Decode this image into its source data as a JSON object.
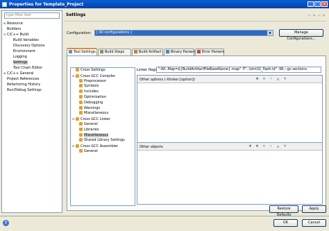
{
  "window": {
    "title": "Properties for Template_Project"
  },
  "left_nav": {
    "filter_placeholder": "type filter text",
    "items": [
      {
        "label": "Resource",
        "indent": 0,
        "expander": "+"
      },
      {
        "label": "Builders",
        "indent": 0,
        "expander": ""
      },
      {
        "label": "C/C++ Build",
        "indent": 0,
        "expander": "-"
      },
      {
        "label": "Build Variables",
        "indent": 1,
        "expander": ""
      },
      {
        "label": "Discovery Options",
        "indent": 1,
        "expander": ""
      },
      {
        "label": "Environment",
        "indent": 1,
        "expander": ""
      },
      {
        "label": "Logging",
        "indent": 1,
        "expander": ""
      },
      {
        "label": "Settings",
        "indent": 1,
        "expander": "",
        "selected": true
      },
      {
        "label": "Tool Chain Editor",
        "indent": 1,
        "expander": ""
      },
      {
        "label": "C/C++ General",
        "indent": 0,
        "expander": "+"
      },
      {
        "label": "Project References",
        "indent": 0,
        "expander": ""
      },
      {
        "label": "Refactoring History",
        "indent": 0,
        "expander": ""
      },
      {
        "label": "Run/Debug Settings",
        "indent": 0,
        "expander": ""
      }
    ]
  },
  "page": {
    "title": "Settings"
  },
  "configuration": {
    "label": "Configuration:",
    "value": "[ All configurations ]",
    "manage_button": "Manage Configurations..."
  },
  "tabs": [
    {
      "label": "Tool Settings",
      "active": true
    },
    {
      "label": "Build Steps"
    },
    {
      "label": "Build Artifact"
    },
    {
      "label": "Binary Parsers"
    },
    {
      "label": "Error Parsers"
    }
  ],
  "tool_tree": [
    {
      "label": "Cross Settings",
      "indent": 0,
      "expander": ""
    },
    {
      "label": "Cross GCC Compiler",
      "indent": 0,
      "expander": "-"
    },
    {
      "label": "Preprocessor",
      "indent": 1
    },
    {
      "label": "Symbols",
      "indent": 1
    },
    {
      "label": "Includes",
      "indent": 1
    },
    {
      "label": "Optimization",
      "indent": 1
    },
    {
      "label": "Debugging",
      "indent": 1
    },
    {
      "label": "Warnings",
      "indent": 1
    },
    {
      "label": "Miscellaneous",
      "indent": 1
    },
    {
      "label": "Cross GCC Linker",
      "indent": 0,
      "expander": "-"
    },
    {
      "label": "General",
      "indent": 1
    },
    {
      "label": "Libraries",
      "indent": 1
    },
    {
      "label": "Miscellaneous",
      "indent": 1,
      "selected": true
    },
    {
      "label": "Shared Library Settings",
      "indent": 1
    },
    {
      "label": "Cross GCC Assembler",
      "indent": 0,
      "expander": "-"
    },
    {
      "label": "General",
      "indent": 1
    }
  ],
  "linker": {
    "flags_label": "Linker flags",
    "flags_value": "\"-Wl,-Map=${BuildArtifactFileBaseName}.map\" -T\"..\\stm32_flash.ld\" -Wl,--gc-sections",
    "other_options_label": "Other options (-Xlinker [option])",
    "other_objects_label": "Other objects"
  },
  "buttons": {
    "restore": "Restore Defaults",
    "apply": "Apply",
    "ok": "OK",
    "cancel": "Cancel"
  },
  "colors": {
    "titlebar": "#0a5fd8",
    "selection": "#316ac5",
    "active_tab": "#e68b2c"
  }
}
